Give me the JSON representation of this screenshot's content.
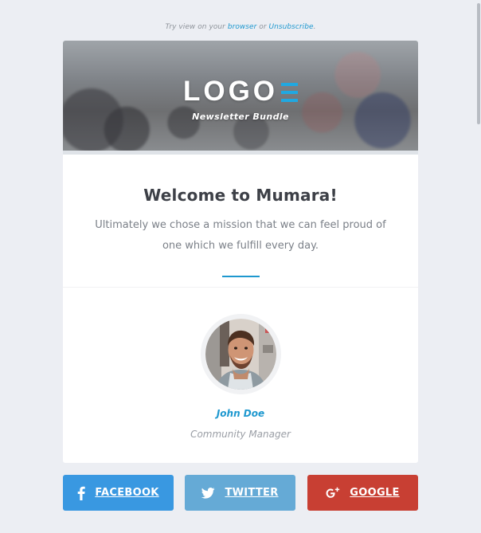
{
  "preheader": {
    "prefix": "Try view on your",
    "browser_link": "browser",
    "middle": "or",
    "unsubscribe_link": "Unsubscribe",
    "suffix": "."
  },
  "hero": {
    "logo_text": "LOGO",
    "subtitle": "Newsletter Bundle"
  },
  "welcome": {
    "title": "Welcome to Mumara!",
    "body": "Ultimately we chose a mission that we can feel proud of one which we fulfill every day."
  },
  "person": {
    "name": "John Doe",
    "role": "Community Manager"
  },
  "social": {
    "facebook": "FACEBOOK",
    "twitter": "TWITTER",
    "google": "GOOGLE"
  },
  "colors": {
    "accent": "#1e98cf",
    "facebook": "#3998e1",
    "twitter": "#65aad6",
    "google": "#c83f33",
    "background": "#eceef3"
  },
  "icons": {
    "logo_mark": "stacked-bars-icon",
    "facebook": "facebook-icon",
    "twitter": "twitter-icon",
    "google": "google-plus-icon"
  }
}
